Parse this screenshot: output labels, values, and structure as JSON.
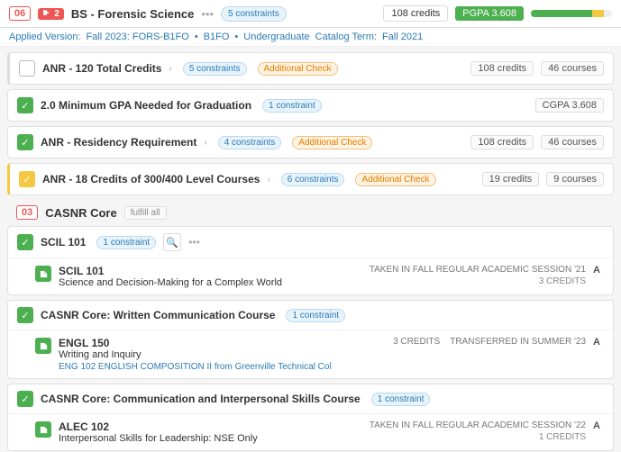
{
  "topbar": {
    "badge06": "06",
    "badge2": "2",
    "degree": "BS - Forensic Science",
    "dots": "•••",
    "constraints": "5 constraints",
    "credits_total": "108 credits",
    "gpa": "PGPA 3.608",
    "progress_green_pct": 75,
    "progress_yellow_pct": 15
  },
  "subbar": {
    "label1": "Applied Version:",
    "val1": "Fall 2023: FORS-B1FO",
    "sep1": "•",
    "val2": "B1FO",
    "sep2": "•",
    "val3": "Undergraduate",
    "label2": "Catalog Term:",
    "val4": "Fall 2021"
  },
  "rows": [
    {
      "id": "anr-total",
      "type": "unchecked",
      "title": "ANR - 120 Total Credits",
      "arrow": "›",
      "badges": [
        "5 constraints",
        "Additional Check"
      ],
      "stats": [
        "108 credits",
        "46 courses"
      ]
    },
    {
      "id": "anr-gpa",
      "type": "green",
      "title": "2.0 Minimum GPA Needed for Graduation",
      "arrow": "",
      "badges": [
        "1 constraint"
      ],
      "stats": [
        "CGPA 3.608"
      ]
    },
    {
      "id": "anr-residency",
      "type": "green",
      "title": "ANR - Residency Requirement",
      "arrow": "›",
      "badges": [
        "4 constraints",
        "Additional Check"
      ],
      "stats": [
        "108 credits",
        "46 courses"
      ]
    },
    {
      "id": "anr-credits",
      "type": "warning",
      "title": "ANR - 18 Credits of 300/400 Level Courses",
      "arrow": "›",
      "badges": [
        "6 constraints",
        "Additional Check"
      ],
      "stats": [
        "19 credits",
        "9 courses"
      ]
    }
  ],
  "casnr_section": {
    "num": "03",
    "name": "CASNR Core",
    "fulfill": "fulfill all",
    "subsections": [
      {
        "id": "scil101-group",
        "title": "SCIL 101",
        "constraints": "1 constraint",
        "courses": [
          {
            "code": "SCIL 101",
            "desc": "Science and Decision-Making for a Complex World",
            "session": "TAKEN IN FALL REGULAR ACADEMIC SESSION '21",
            "grade": "A",
            "credits": "3 CREDITS",
            "sub": ""
          }
        ]
      },
      {
        "id": "written-comm",
        "title": "CASNR Core: Written Communication Course",
        "constraints": "1 constraint",
        "courses": [
          {
            "code": "ENGL 150",
            "desc": "Writing and Inquiry",
            "session": "3 CREDITS    TRANSFERRED IN SUMMER '23",
            "grade": "A",
            "credits": "",
            "sub": "ENG 102 ENGLISH COMPOSITION II from Greenville Technical Col"
          }
        ]
      },
      {
        "id": "interpersonal",
        "title": "CASNR Core: Communication and Interpersonal Skills Course",
        "constraints": "1 constraint",
        "courses": [
          {
            "code": "ALEC 102",
            "desc": "Interpersonal Skills for Leadership: NSE Only",
            "session": "TAKEN IN FALL REGULAR ACADEMIC SESSION '22",
            "grade": "A",
            "credits": "1 CREDITS",
            "sub": ""
          }
        ]
      }
    ]
  }
}
